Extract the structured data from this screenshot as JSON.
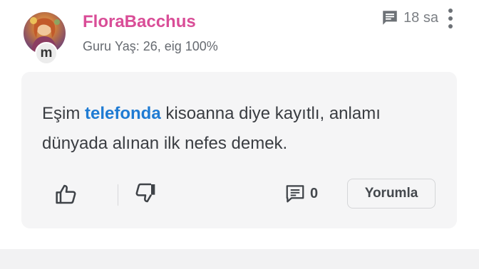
{
  "post": {
    "author": {
      "name": "FloraBacchus",
      "rank": "Guru",
      "age_label": "Yaş: 26, eig 100%",
      "badge_letter": "m",
      "name_color": "#d94d97"
    },
    "time": {
      "icon": "message-square-icon",
      "label": "18 sa"
    },
    "more_icon": "more-vertical-icon",
    "comment": {
      "before": "Eşim",
      "keyword": "telefonda",
      "after": "kisoanna diye kayıtlı, anlamı dünyada alınan ilk nefes demek.",
      "keyword_color": "#1f7bd3"
    },
    "actions": {
      "like_icon": "thumbs-up-icon",
      "dislike_icon": "thumbs-down-icon",
      "comments_icon": "comment-icon",
      "comments_count": "0",
      "reply_label": "Yorumla"
    }
  }
}
